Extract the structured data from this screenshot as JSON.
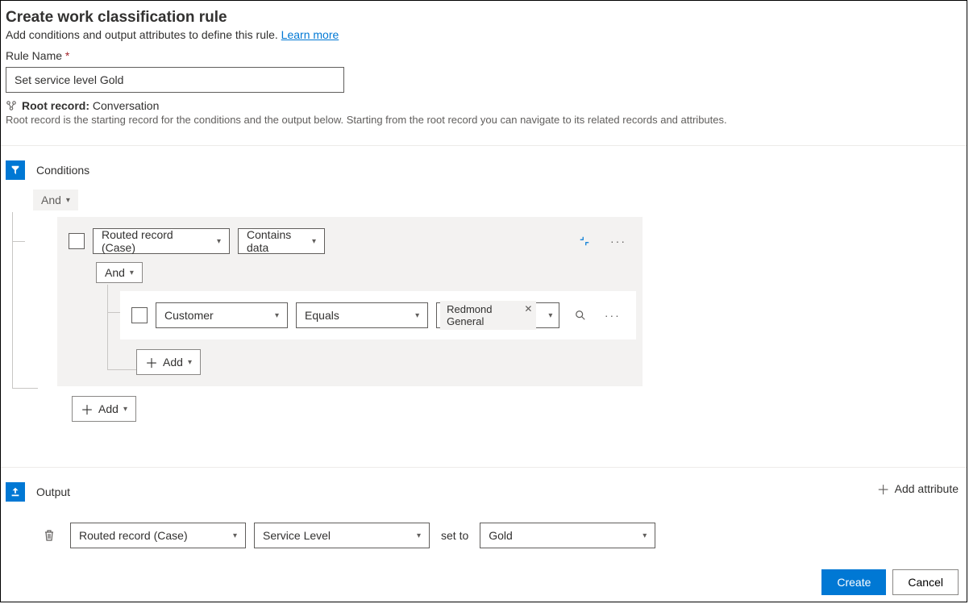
{
  "header": {
    "title": "Create work classification rule",
    "subtitle_prefix": "Add conditions and output attributes to define this rule. ",
    "learn_more": "Learn more"
  },
  "rule_name": {
    "label": "Rule Name",
    "value": "Set service level Gold"
  },
  "root_record": {
    "label": "Root record:",
    "value": "Conversation",
    "description": "Root record is the starting record for the conditions and the output below. Starting from the root record you can navigate to its related records and attributes."
  },
  "conditions": {
    "title": "Conditions",
    "top_operator": "And",
    "row1_field": "Routed record (Case)",
    "row1_operator": "Contains data",
    "nested_operator": "And",
    "row2_field": "Customer",
    "row2_operator": "Equals",
    "row2_value": "Redmond General",
    "add_label": "Add"
  },
  "output": {
    "title": "Output",
    "add_attribute": "Add attribute",
    "row_entity": "Routed record (Case)",
    "row_attribute": "Service Level",
    "set_to": "set to",
    "row_value": "Gold"
  },
  "footer": {
    "create": "Create",
    "cancel": "Cancel"
  }
}
